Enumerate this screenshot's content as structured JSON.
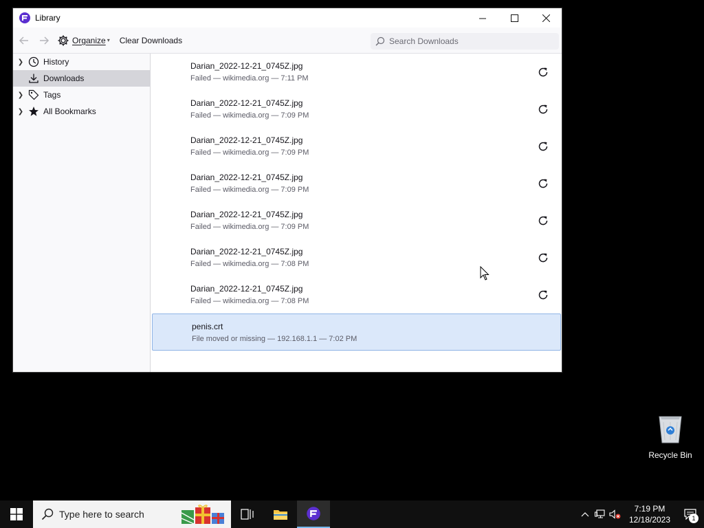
{
  "window": {
    "title": "Library",
    "controls": {
      "minimize": "—",
      "maximize": "☐",
      "close": "✕"
    }
  },
  "toolbar": {
    "organize_label": "Organize",
    "clear_label": "Clear Downloads",
    "search_placeholder": "Search Downloads"
  },
  "sidebar": {
    "items": [
      {
        "label": "History",
        "icon": "clock-icon",
        "expandable": true,
        "selected": false
      },
      {
        "label": "Downloads",
        "icon": "download-icon",
        "expandable": false,
        "selected": true
      },
      {
        "label": "Tags",
        "icon": "tag-icon",
        "expandable": true,
        "selected": false
      },
      {
        "label": "All Bookmarks",
        "icon": "star-icon",
        "expandable": true,
        "selected": false
      }
    ]
  },
  "downloads": [
    {
      "name": "Darian_2022-12-21_0745Z.jpg",
      "status": "Failed — wikimedia.org — 7:11 PM",
      "retry": true
    },
    {
      "name": "Darian_2022-12-21_0745Z.jpg",
      "status": "Failed — wikimedia.org — 7:09 PM",
      "retry": true
    },
    {
      "name": "Darian_2022-12-21_0745Z.jpg",
      "status": "Failed — wikimedia.org — 7:09 PM",
      "retry": true
    },
    {
      "name": "Darian_2022-12-21_0745Z.jpg",
      "status": "Failed — wikimedia.org — 7:09 PM",
      "retry": true
    },
    {
      "name": "Darian_2022-12-21_0745Z.jpg",
      "status": "Failed — wikimedia.org — 7:09 PM",
      "retry": true
    },
    {
      "name": "Darian_2022-12-21_0745Z.jpg",
      "status": "Failed — wikimedia.org — 7:08 PM",
      "retry": true
    },
    {
      "name": "Darian_2022-12-21_0745Z.jpg",
      "status": "Failed — wikimedia.org — 7:08 PM",
      "retry": true
    },
    {
      "name": "penis.crt",
      "status": "File moved or missing — 192.168.1.1 — 7:02 PM",
      "retry": false,
      "selected": true
    }
  ],
  "desktop": {
    "recycle_bin_label": "Recycle Bin"
  },
  "taskbar": {
    "search_placeholder": "Type here to search",
    "clock_time": "7:19 PM",
    "clock_date": "12/18/2023",
    "notification_count": "1"
  },
  "colors": {
    "selection_bg": "#dbe8fa",
    "selection_border": "#8fb4e6",
    "sidebar_selected": "#d5d5da",
    "taskbar_bg": "#101010",
    "accent": "#76b9ed"
  }
}
